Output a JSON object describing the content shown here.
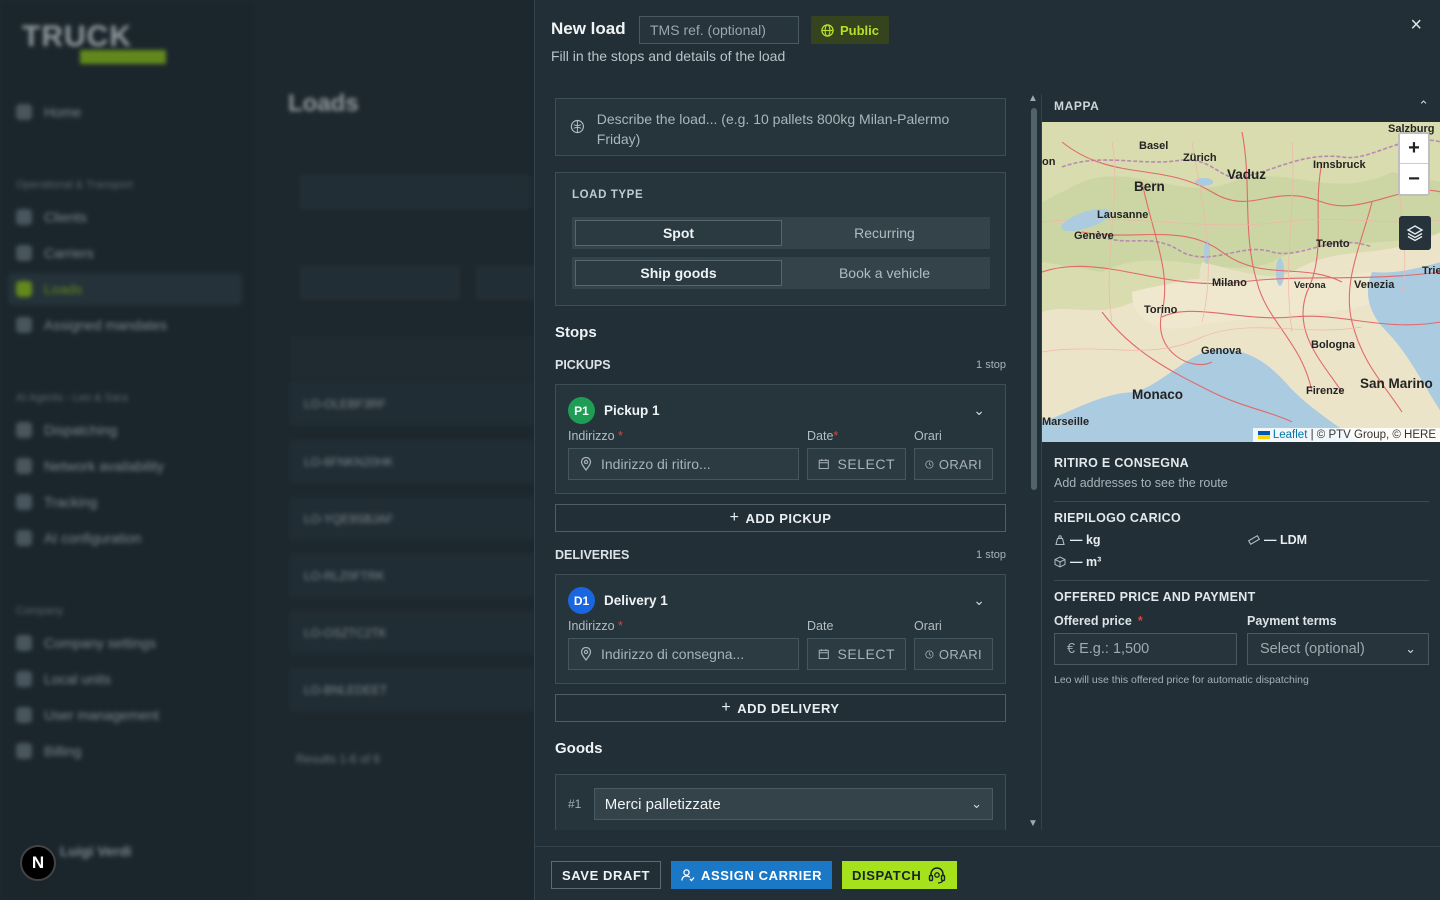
{
  "background": {
    "logo_text": "TRUCK",
    "nav": [
      "Home",
      "Clients",
      "Carriers",
      "Loads",
      "Assigned mandates",
      "Dispatching",
      "Network availability",
      "Tracking",
      "AI configuration",
      "Company settings",
      "Local units",
      "User management",
      "Billing"
    ],
    "sections": [
      "Operational & Transport",
      "AI Agents - Leo & Sara",
      "Company"
    ],
    "page_title": "Loads",
    "rows": [
      "LO-OLEBF3RF",
      "LO-6FNKN20HK",
      "LO-YQE9SBJAF",
      "LO-RLZ0FTRK",
      "LO-OSZTC2TK",
      "LO-BNLEDEET"
    ],
    "results": "Results 1-6 of 6",
    "user": "Luigi Verdi",
    "avatar_letter": "N"
  },
  "header": {
    "title": "New load",
    "tms_placeholder": "TMS ref. (optional)",
    "visibility": "Public",
    "subtitle": "Fill in the stops and details of the load",
    "close": "×"
  },
  "describe": {
    "placeholder": "Describe the load... (e.g. 10 pallets 800kg Milan-Palermo Friday)"
  },
  "load_type": {
    "caption": "LOAD TYPE",
    "mode": [
      "Spot",
      "Recurring"
    ],
    "mode_selected": "Spot",
    "kind": [
      "Ship goods",
      "Book a vehicle"
    ],
    "kind_selected": "Ship goods"
  },
  "stops": {
    "title": "Stops",
    "pickups": {
      "caption": "PICKUPS",
      "count": "1 stop",
      "badge": "P1",
      "name": "Pickup 1",
      "address_label": "Indirizzo",
      "address_placeholder": "Indirizzo di ritiro...",
      "date_label": "Date",
      "date_value": "SELECT",
      "time_label": "Orari",
      "time_value": "ORARI",
      "add": "ADD PICKUP"
    },
    "deliveries": {
      "caption": "DELIVERIES",
      "count": "1 stop",
      "badge": "D1",
      "name": "Delivery 1",
      "address_label": "Indirizzo",
      "address_placeholder": "Indirizzo di consegna...",
      "date_label": "Date",
      "date_value": "SELECT",
      "time_label": "Orari",
      "time_value": "ORARI",
      "add": "ADD DELIVERY"
    }
  },
  "goods": {
    "title": "Goods",
    "index": "#1",
    "type": "Merci palletizzate"
  },
  "map": {
    "caption": "MAPPA",
    "cities": [
      {
        "name": "Salzburg",
        "big": false
      },
      {
        "name": "Basel",
        "big": false
      },
      {
        "name": "Zürich",
        "big": false
      },
      {
        "name": "Vaduz",
        "big": true
      },
      {
        "name": "Innsbruck",
        "big": false
      },
      {
        "name": "Bern",
        "big": true
      },
      {
        "name": "Lausanne",
        "big": false
      },
      {
        "name": "Genève",
        "big": false
      },
      {
        "name": "Trento",
        "big": false
      },
      {
        "name": "Trie",
        "big": false
      },
      {
        "name": "Milano",
        "big": false
      },
      {
        "name": "Verona",
        "big": false
      },
      {
        "name": "Venezia",
        "big": false
      },
      {
        "name": "Torino",
        "big": false
      },
      {
        "name": "Bologna",
        "big": false
      },
      {
        "name": "Genova",
        "big": false
      },
      {
        "name": "San Marino",
        "big": true
      },
      {
        "name": "Firenze",
        "big": false
      },
      {
        "name": "Monaco",
        "big": true
      },
      {
        "name": "Marseille",
        "big": false
      },
      {
        "name": "on",
        "big": false
      }
    ],
    "zoom_in": "+",
    "zoom_out": "−",
    "attribution_leaflet": "Leaflet",
    "attribution_rest": "| © PTV Group, © HERE"
  },
  "route": {
    "caption": "RITIRO E CONSEGNA",
    "text": "Add addresses to see the route"
  },
  "summary": {
    "caption": "RIEPILOGO CARICO",
    "weight": "— kg",
    "ldm": "— LDM",
    "volume": "— m³"
  },
  "price": {
    "caption": "OFFERED PRICE AND PAYMENT",
    "price_label": "Offered price",
    "price_placeholder": "€  E.g.: 1,500",
    "terms_label": "Payment terms",
    "terms_placeholder": "Select (optional)",
    "note": "Leo will use this offered price for automatic dispatching"
  },
  "footer": {
    "save_draft": "SAVE DRAFT",
    "assign": "ASSIGN CARRIER",
    "dispatch": "DISPATCH"
  },
  "colors": {
    "accent_green": "#a6e21c",
    "assign_blue": "#1b78c7",
    "pickup_badge": "#1f9d55",
    "delivery_badge": "#1a66e0",
    "required": "#e0433b"
  }
}
